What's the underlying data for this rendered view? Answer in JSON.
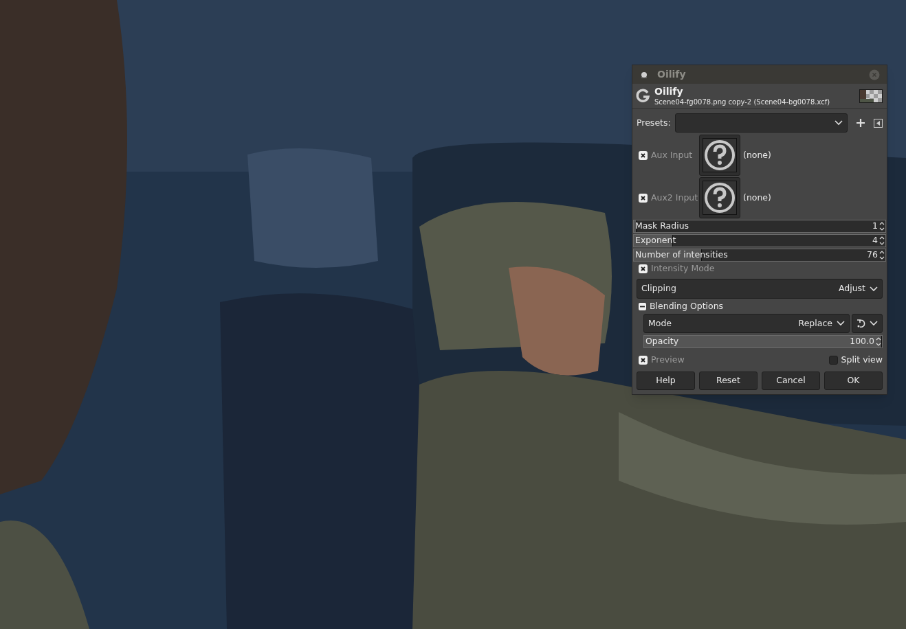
{
  "dialog": {
    "title": "Oilify",
    "header": {
      "title": "Oilify",
      "subtitle": "Scene04-fg0078.png copy-2 (Scene04-bg0078.xcf)"
    },
    "presets": {
      "label": "Presets:"
    },
    "aux_inputs": [
      {
        "label": "Aux Input",
        "checked": true,
        "value": "(none)"
      },
      {
        "label": "Aux2 Input",
        "checked": true,
        "value": "(none)"
      }
    ],
    "sliders": [
      {
        "label": "Mask Radius",
        "value": "1",
        "level": 0.01
      },
      {
        "label": "Exponent",
        "value": "4",
        "level": 0.155
      },
      {
        "label": "Number of intensities",
        "value": "76",
        "level": 0.27
      }
    ],
    "intensity_mode": {
      "label": "Intensity Mode",
      "checked": true
    },
    "clipping": {
      "label": "Clipping",
      "value": "Adjust"
    },
    "blending": {
      "label": "Blending Options",
      "expanded": true,
      "mode": {
        "label": "Mode",
        "value": "Replace"
      },
      "opacity": {
        "label": "Opacity",
        "value": "100.0",
        "level": 1
      }
    },
    "preview": {
      "label": "Preview",
      "checked": true
    },
    "split_view": {
      "label": "Split view",
      "checked": false
    },
    "buttons": [
      "Help",
      "Reset",
      "Cancel",
      "OK"
    ]
  }
}
